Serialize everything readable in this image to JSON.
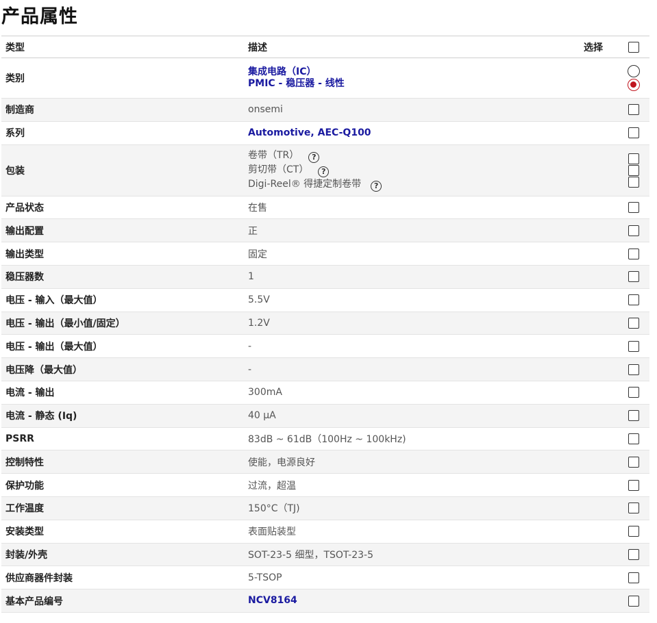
{
  "title": "产品属性",
  "header": {
    "type": "类型",
    "description": "描述",
    "select": "选择"
  },
  "rows": {
    "category": {
      "attr": "类别",
      "value1": "集成电路（IC）",
      "value2": "PMIC - 稳压器 - 线性"
    },
    "manufacturer": {
      "attr": "制造商",
      "value": "onsemi"
    },
    "series": {
      "attr": "系列",
      "value": "Automotive, AEC-Q100"
    },
    "packaging": {
      "attr": "包装",
      "value1": "卷带（TR）",
      "value2": "剪切带（CT）",
      "value3": "Digi-Reel® 得捷定制卷带"
    },
    "status": {
      "attr": "产品状态",
      "value": "在售"
    },
    "output_config": {
      "attr": "输出配置",
      "value": "正"
    },
    "output_type": {
      "attr": "输出类型",
      "value": "固定"
    },
    "regulators": {
      "attr": "稳压器数",
      "value": "1"
    },
    "vin_max": {
      "attr": "电压 - 输入（最大值）",
      "value": "5.5V"
    },
    "vout_min": {
      "attr": "电压 - 输出（最小值/固定）",
      "value": "1.2V"
    },
    "vout_max": {
      "attr": "电压 - 输出（最大值）",
      "value": "-"
    },
    "dropout": {
      "attr": "电压降（最大值）",
      "value": "-"
    },
    "iout": {
      "attr": "电流 - 输出",
      "value": "300mA"
    },
    "iq": {
      "attr": "电流 - 静态 (Iq)",
      "value": "40 µA"
    },
    "psrr": {
      "attr": "PSRR",
      "value": "83dB ~ 61dB（100Hz ~ 100kHz)"
    },
    "control": {
      "attr": "控制特性",
      "value": "使能，电源良好"
    },
    "protection": {
      "attr": "保护功能",
      "value": "过流，超温"
    },
    "temp": {
      "attr": "工作温度",
      "value": "150°C（TJ)"
    },
    "mount": {
      "attr": "安装类型",
      "value": "表面贴装型"
    },
    "case": {
      "attr": "封装/外壳",
      "value": "SOT-23-5 细型，TSOT-23-5"
    },
    "supplier_pkg": {
      "attr": "供应商器件封装",
      "value": "5-TSOP"
    },
    "base_pn": {
      "attr": "基本产品编号",
      "value": "NCV8164"
    }
  },
  "icons": {
    "help": "?",
    "help_name": "question-circle-icon"
  },
  "colors": {
    "link": "#1a1aa0",
    "radio_selected": "#c0141d"
  }
}
